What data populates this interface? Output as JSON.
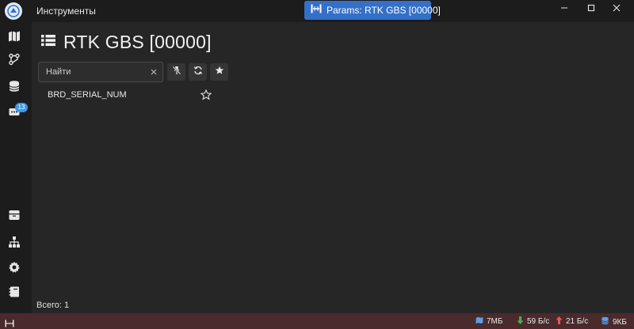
{
  "titlebar": {
    "app_title": "Инструменты",
    "active_tab": "Params: RTK GBS [00000]"
  },
  "sidebar": {
    "badge_count": "13"
  },
  "page": {
    "title": "RTK GBS [00000]",
    "search_placeholder": "Найти"
  },
  "params": [
    {
      "name": "BRD_SERIAL_NUM"
    }
  ],
  "footer": {
    "total": "Всего: 1"
  },
  "statusbar": {
    "memory": "7МБ",
    "rx": "59 Б/с",
    "tx": "21 Б/с",
    "storage": "9КБ"
  },
  "colors": {
    "accent": "#3470c8",
    "statusbar_bg": "#4a2a2c",
    "rx_arrow": "#4caf50",
    "tx_arrow": "#e85555"
  }
}
